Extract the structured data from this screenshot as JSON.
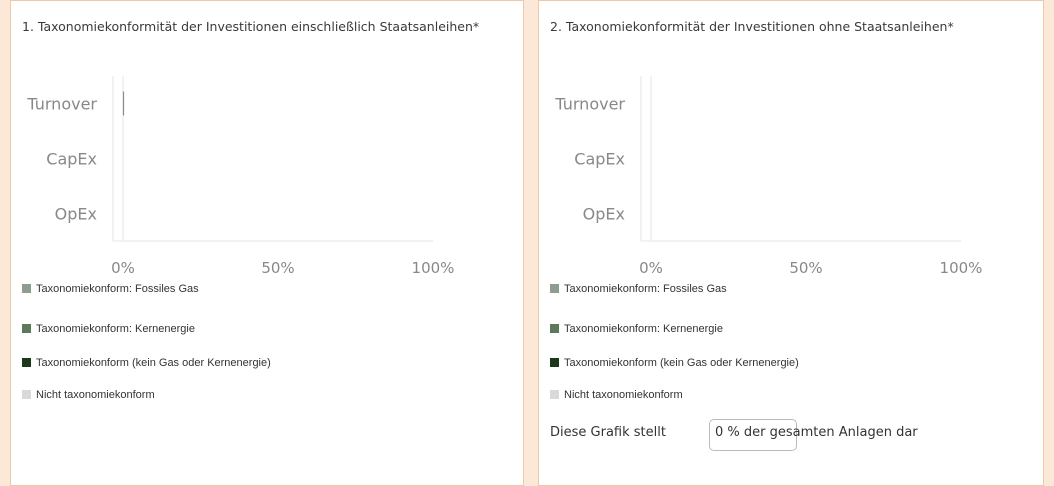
{
  "colors": {
    "fossil_gas": "#8e9e8e",
    "nuclear": "#5b7a5b",
    "other_aligned": "#1a3a1a",
    "not_aligned": "#d9d9d9",
    "axis_text": "#888888",
    "axis_line": "#e6e6e6"
  },
  "legend": [
    {
      "label": "Taxonomiekonform: Fossiles Gas",
      "color": "#8e9e8e"
    },
    {
      "label": "Taxonomiekonform: Kernenergie",
      "color": "#5b7a5b"
    },
    {
      "label": "Taxonomiekonform (kein Gas oder Kernenergie)",
      "color": "#1a3a1a"
    },
    {
      "label": "Nicht taxonomiekonform",
      "color": "#d9d9d9"
    }
  ],
  "panel1": {
    "title": "1. Taxonomiekonformität der Investitionen einschließlich Staatsanleihen*"
  },
  "panel2": {
    "title": "2. Taxonomiekonformität der Investitionen ohne Staatsanleihen*",
    "note_prefix": "Diese Grafik stellt",
    "note_value": "0 % der gesamten Anlagen dar"
  },
  "chart_data": [
    {
      "type": "bar",
      "orientation": "horizontal",
      "stacked": true,
      "categories": [
        "Turnover",
        "CapEx",
        "OpEx"
      ],
      "x_ticks": [
        "0%",
        "50%",
        "100%"
      ],
      "xlim": [
        0,
        100
      ],
      "series": [
        {
          "name": "Taxonomiekonform: Fossiles Gas",
          "values": [
            0,
            0,
            0
          ]
        },
        {
          "name": "Taxonomiekonform: Kernenergie",
          "values": [
            0,
            0,
            0
          ]
        },
        {
          "name": "Taxonomiekonform (kein Gas oder Kernenergie)",
          "values": [
            0,
            0,
            0
          ]
        },
        {
          "name": "Nicht taxonomiekonform",
          "values": [
            0,
            0,
            0
          ]
        }
      ]
    },
    {
      "type": "bar",
      "orientation": "horizontal",
      "stacked": true,
      "categories": [
        "Turnover",
        "CapEx",
        "OpEx"
      ],
      "x_ticks": [
        "0%",
        "50%",
        "100%"
      ],
      "xlim": [
        0,
        100
      ],
      "series": [
        {
          "name": "Taxonomiekonform: Fossiles Gas",
          "values": [
            0,
            0,
            0
          ]
        },
        {
          "name": "Taxonomiekonform: Kernenergie",
          "values": [
            0,
            0,
            0
          ]
        },
        {
          "name": "Taxonomiekonform (kein Gas oder Kernenergie)",
          "values": [
            0,
            0,
            0
          ]
        },
        {
          "name": "Nicht taxonomiekonform",
          "values": [
            0,
            0,
            0
          ]
        }
      ]
    }
  ]
}
